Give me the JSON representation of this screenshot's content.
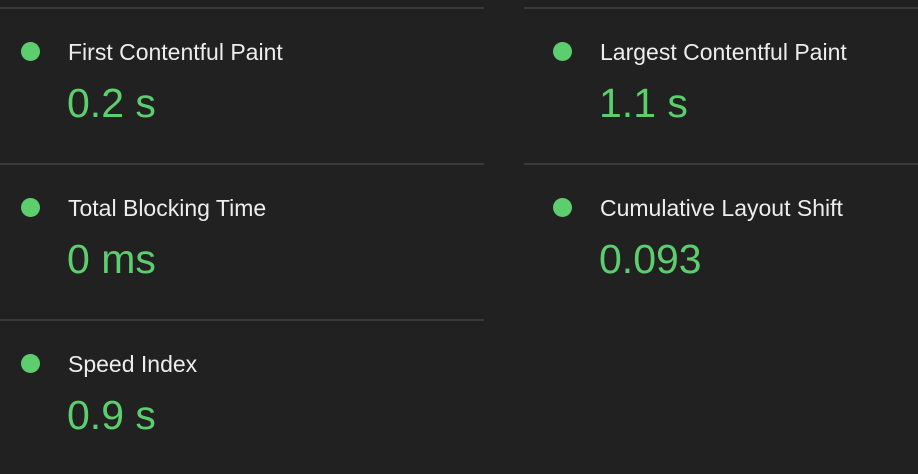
{
  "colors": {
    "background": "#212121",
    "divider": "#3a3a3a",
    "title_text": "#ededed",
    "pass": "#5cce6e"
  },
  "metrics": [
    {
      "title": "First Contentful Paint",
      "value": "0.2 s",
      "status": "pass",
      "status_icon": "green-circle-icon"
    },
    {
      "title": "Largest Contentful Paint",
      "value": "1.1 s",
      "status": "pass",
      "status_icon": "green-circle-icon"
    },
    {
      "title": "Total Blocking Time",
      "value": "0 ms",
      "status": "pass",
      "status_icon": "green-circle-icon"
    },
    {
      "title": "Cumulative Layout Shift",
      "value": "0.093",
      "status": "pass",
      "status_icon": "green-circle-icon"
    },
    {
      "title": "Speed Index",
      "value": "0.9 s",
      "status": "pass",
      "status_icon": "green-circle-icon"
    }
  ]
}
